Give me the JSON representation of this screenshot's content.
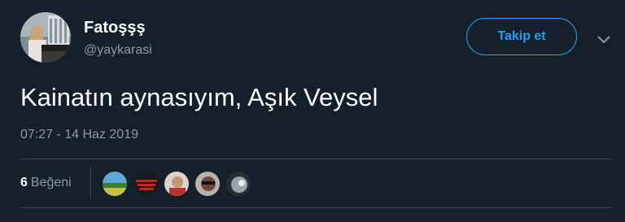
{
  "tweet": {
    "display_name": "Fatoşşş",
    "handle": "@yaykarasi",
    "follow_label": "Takip et",
    "text": "Kainatın aynasıyım, Aşık Veysel",
    "timestamp": "07:27 - 14 Haz 2019",
    "likes": {
      "count": "6",
      "label": "Beğeni",
      "avatars": [
        {
          "name": "liker-1",
          "color": "#4f8f3a"
        },
        {
          "name": "liker-2",
          "color": "#b81414"
        },
        {
          "name": "liker-3",
          "color": "#c9a27a"
        },
        {
          "name": "liker-4",
          "color": "#6a4a3a"
        },
        {
          "name": "liker-5",
          "color": "#9aa3a8"
        }
      ]
    }
  },
  "icons": {
    "caret": "chevron-down-icon"
  },
  "colors": {
    "background": "#15202b",
    "accent": "#1da1f2",
    "secondary_text": "#8899a6",
    "divider": "#38444d"
  }
}
